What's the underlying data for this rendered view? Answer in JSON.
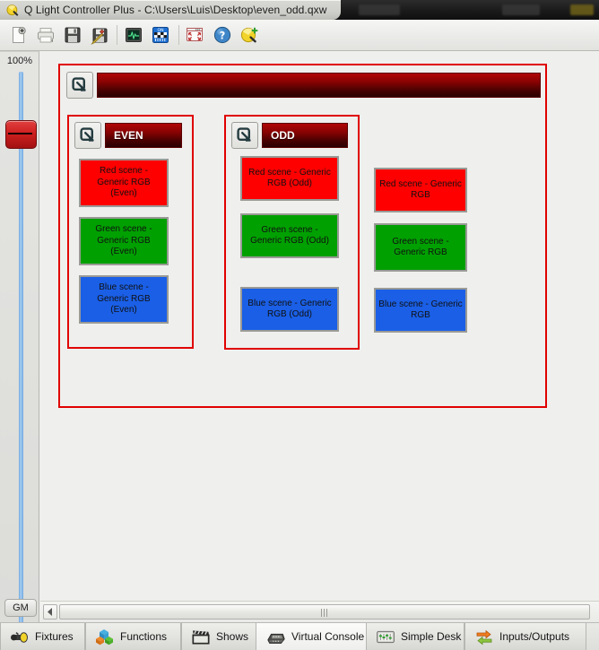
{
  "window": {
    "title": "Q Light Controller Plus - C:\\Users\\Luis\\Desktop\\even_odd.qxw",
    "app_icon": "qlc-logo-icon"
  },
  "toolbar": {
    "items": [
      {
        "name": "new-document-button",
        "tip": "New"
      },
      {
        "name": "open-document-button",
        "tip": "Open"
      },
      {
        "name": "save-document-button",
        "tip": "Save"
      },
      {
        "name": "save-as-document-button",
        "tip": "Save As"
      },
      {
        "name": "monitor-button",
        "tip": "Monitor"
      },
      {
        "name": "dmx-address-tool-button",
        "tip": "Address Tool"
      },
      {
        "name": "fullscreen-button",
        "tip": "Toggle Full Screen"
      },
      {
        "name": "help-button",
        "tip": "Help"
      },
      {
        "name": "blackout-button",
        "tip": "Blackout"
      }
    ]
  },
  "grand_master": {
    "percent_label": "100%",
    "button_label": "GM",
    "value": 100
  },
  "virtual_console": {
    "main_frame": {
      "name": "main-frame",
      "title": "",
      "collapse_icon": "collapse-frame-icon",
      "border_color": "#e00000"
    },
    "sub_frames": [
      {
        "name": "even-frame",
        "title": "EVEN",
        "collapse_icon": "collapse-frame-icon",
        "buttons": [
          {
            "label": "Red scene - Generic RGB (Even)",
            "color": "#ff0000",
            "name": "button-red-scene-even"
          },
          {
            "label": "Green scene - Generic RGB (Even)",
            "color": "#00a000",
            "name": "button-green-scene-even"
          },
          {
            "label": "Blue scene - Generic RGB (Even)",
            "color": "#1a5fe6",
            "name": "button-blue-scene-even"
          }
        ]
      },
      {
        "name": "odd-frame",
        "title": "ODD",
        "collapse_icon": "collapse-frame-icon",
        "buttons": [
          {
            "label": "Red scene - Generic RGB (Odd)",
            "color": "#ff0000",
            "name": "button-red-scene-odd"
          },
          {
            "label": "Green scene - Generic RGB (Odd)",
            "color": "#00a000",
            "name": "button-green-scene-odd"
          },
          {
            "label": "Blue scene - Generic RGB (Odd)",
            "color": "#1a5fe6",
            "name": "button-blue-scene-odd"
          }
        ]
      }
    ],
    "loose_buttons": [
      {
        "label": "Red scene - Generic RGB",
        "color": "#ff0000",
        "name": "button-red-scene"
      },
      {
        "label": "Green scene - Generic RGB",
        "color": "#00a000",
        "name": "button-green-scene"
      },
      {
        "label": "Blue scene - Generic RGB",
        "color": "#1a5fe6",
        "name": "button-blue-scene"
      }
    ]
  },
  "tabs": [
    {
      "label": "Fixtures",
      "icon": "fixture-light-icon",
      "active": false
    },
    {
      "label": "Functions",
      "icon": "colored-cubes-icon",
      "active": false
    },
    {
      "label": "Shows",
      "icon": "clapperboard-icon",
      "active": false
    },
    {
      "label": "Virtual Console",
      "icon": "mixer-console-icon",
      "active": true
    },
    {
      "label": "Simple Desk",
      "icon": "faders-icon",
      "active": false
    },
    {
      "label": "Inputs/Outputs",
      "icon": "in-out-arrows-icon",
      "active": false
    }
  ],
  "scrollbar": {
    "left_arrow": "scroll-left-arrow-icon",
    "grip": "scroll-grip-icon"
  }
}
